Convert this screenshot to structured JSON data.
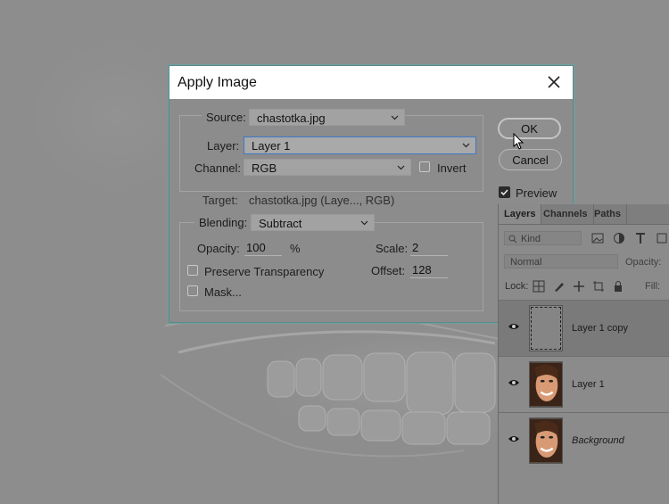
{
  "dialog": {
    "title": "Apply Image",
    "source_label": "Source:",
    "source_value": "chastotka.jpg",
    "layer_label": "Layer:",
    "layer_value": "Layer 1",
    "channel_label": "Channel:",
    "channel_value": "RGB",
    "invert_label": "Invert",
    "invert_checked": false,
    "target_label": "Target:",
    "target_value": "chastotka.jpg (Laye..., RGB)",
    "blending_label": "Blending:",
    "blending_value": "Subtract",
    "opacity_label": "Opacity:",
    "opacity_value": "100",
    "opacity_unit": "%",
    "scale_label": "Scale:",
    "scale_value": "2",
    "offset_label": "Offset:",
    "offset_value": "128",
    "preserve_label": "Preserve Transparency",
    "preserve_checked": false,
    "mask_label": "Mask...",
    "mask_checked": false,
    "ok_label": "OK",
    "cancel_label": "Cancel",
    "preview_label": "Preview",
    "preview_checked": true
  },
  "layers_panel": {
    "tabs": [
      "Layers",
      "Channels",
      "Paths"
    ],
    "active_tab": "Layers",
    "filter_value": "Kind",
    "blend_mode": "Normal",
    "opacity_label": "Opacity:",
    "lock_label": "Lock:",
    "fill_label": "Fill:",
    "layers": [
      {
        "name": "Layer 1 copy",
        "selected": true,
        "visible": true,
        "italic": false
      },
      {
        "name": "Layer 1",
        "selected": false,
        "visible": true,
        "italic": false
      },
      {
        "name": "Background",
        "selected": false,
        "visible": true,
        "italic": true
      }
    ]
  },
  "colors": {
    "canvas_gray": "#8d8d8d",
    "focus_blue": "#3b78c7",
    "dialog_border": "#5a8a8a"
  }
}
